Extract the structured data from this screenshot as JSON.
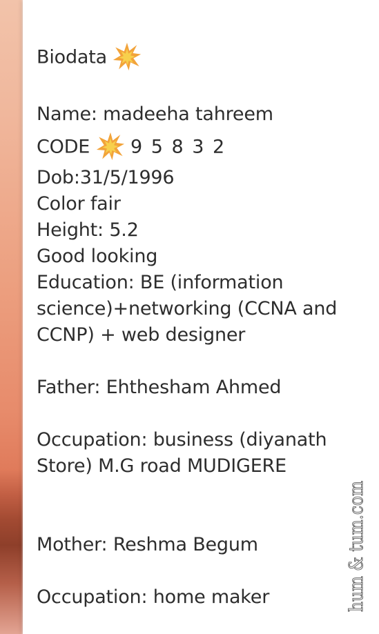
{
  "biodata": {
    "title": "Biodata",
    "name": "Name: madeeha tahreem",
    "code_label": "CODE",
    "code_value": "9 5 8 3 2",
    "dob": "Dob:31/5/1996",
    "color": "Color fair",
    "height": "Height: 5.2",
    "looks": "Good looking",
    "education_1": "Education: BE (information",
    "education_2": "science)+networking (CCNA and",
    "education_3": "CCNP) + web designer",
    "father": "Father: Ehthesham Ahmed",
    "father_occupation_1": "Occupation: business (diyanath",
    "father_occupation_2": "Store) M.G road MUDIGERE",
    "mother": "Mother: Reshma Begum",
    "mother_occupation": "Occupation: home maker"
  },
  "icons": {
    "title_emoji": "collision-emoji-icon",
    "code_emoji": "collision-emoji-icon"
  },
  "watermark": {
    "text": "hum & tum.com"
  },
  "colors": {
    "text": "#2d2d2d",
    "background": "#ffffff",
    "emoji_outer": "#f2a33a",
    "emoji_inner": "#f7d04c",
    "watermark": "#ffffff"
  }
}
